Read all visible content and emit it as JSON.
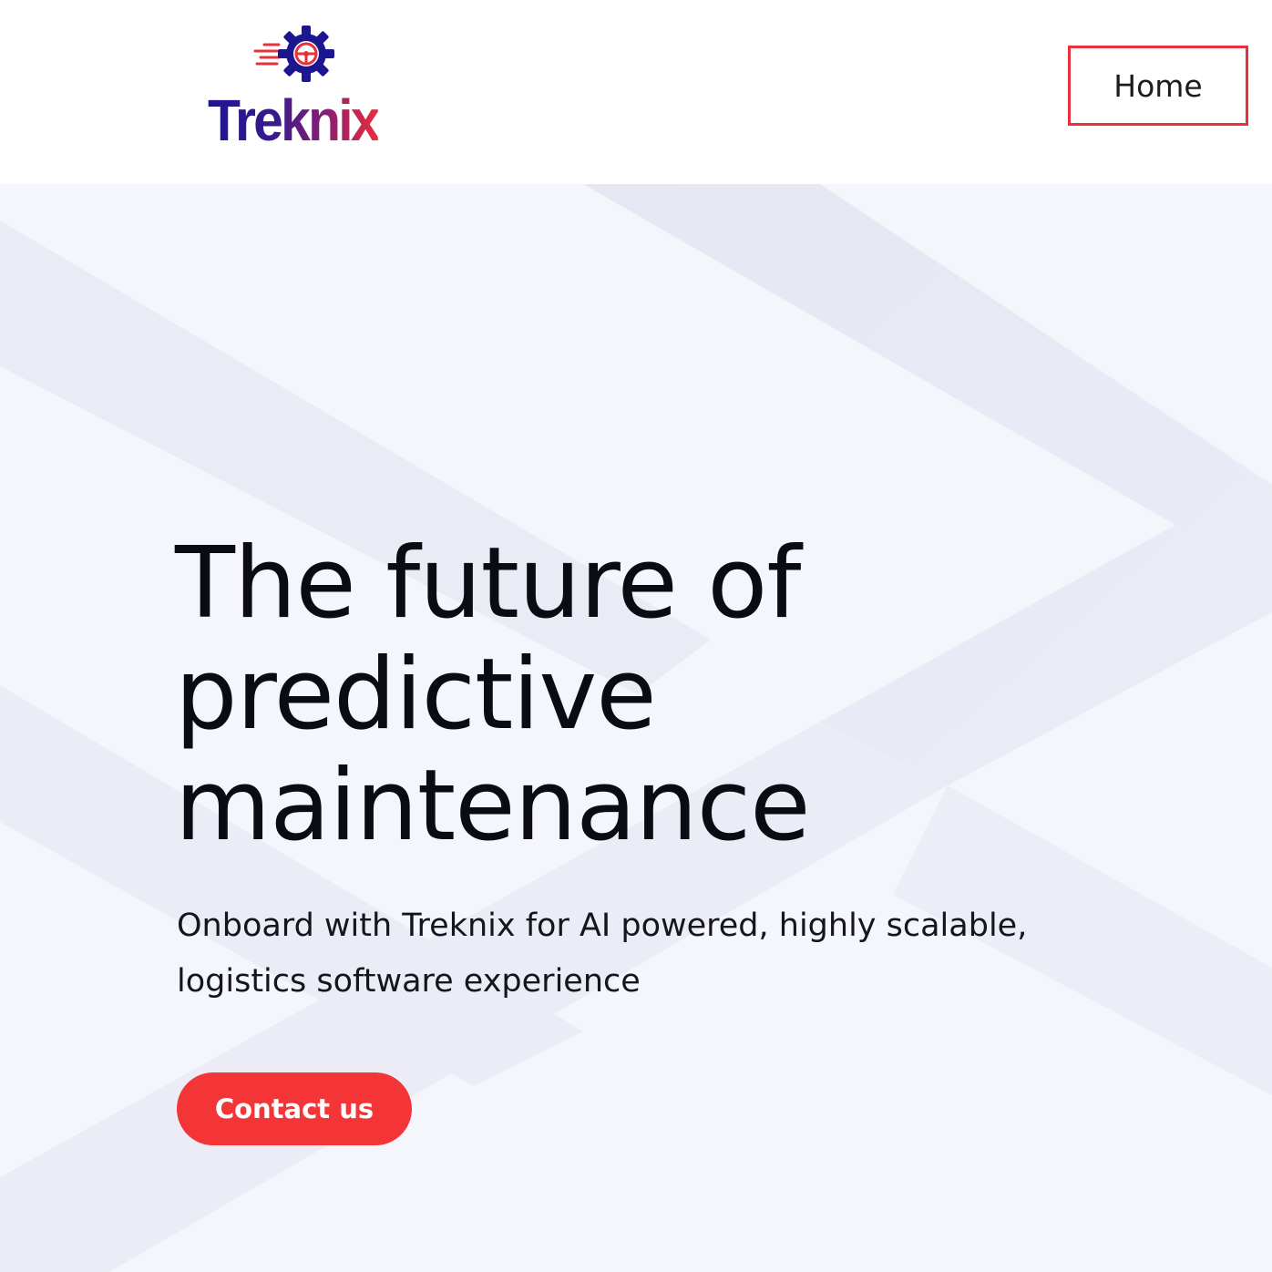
{
  "header": {
    "logo_text": "Treknix",
    "nav": {
      "home_label": "Home"
    }
  },
  "hero": {
    "headline_lines": [
      "The future of",
      "predictive",
      "maintenance"
    ],
    "subtitle": "Onboard with Treknix for AI powered, highly scalable, logistics software experience",
    "cta_label": "Contact us"
  },
  "colors": {
    "accent": "#f33537",
    "nav_highlight_border": "#e8323b",
    "brand_blue": "#1c1690",
    "background": "#f5f5fc",
    "text": "#0b0b12"
  },
  "icons": {
    "logo_mark": "gear-steering-wheel-icon"
  }
}
